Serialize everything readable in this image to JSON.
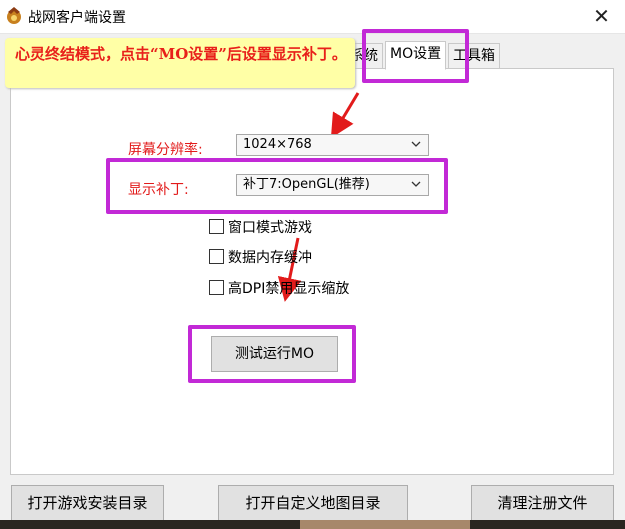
{
  "window": {
    "title": "战网客户端设置",
    "close_glyph": "✕"
  },
  "callout": {
    "text": "心灵终结模式，点击“MO设置”后设置显示补丁。"
  },
  "tabs": [
    {
      "label": "系统",
      "active": false
    },
    {
      "label": "MO设置",
      "active": true
    },
    {
      "label": "工具箱",
      "active": false
    }
  ],
  "settings": {
    "resolution_label": "屏幕分辨率:",
    "resolution_value": "1024×768",
    "patch_label": "显示补丁:",
    "patch_value": "补丁7:OpenGL(推荐)"
  },
  "options": [
    {
      "label": "窗口模式游戏",
      "checked": false
    },
    {
      "label": "数据内存缓冲",
      "checked": false
    },
    {
      "label": "高DPI禁用显示缩放",
      "checked": false
    }
  ],
  "test_button": "测试运行MO",
  "footer": {
    "open_game_dir": "打开游戏安装目录",
    "open_map_dir": "打开自定义地图目录",
    "clean_registry": "清理注册文件"
  },
  "colors": {
    "highlight": "#c229d6",
    "arrow": "#e21b1b",
    "label_red": "#e21b1b",
    "callout_bg": "#ffffa6"
  },
  "icons": [
    "app-icon",
    "close-icon",
    "chevron-down-icon",
    "annotation-arrow"
  ]
}
